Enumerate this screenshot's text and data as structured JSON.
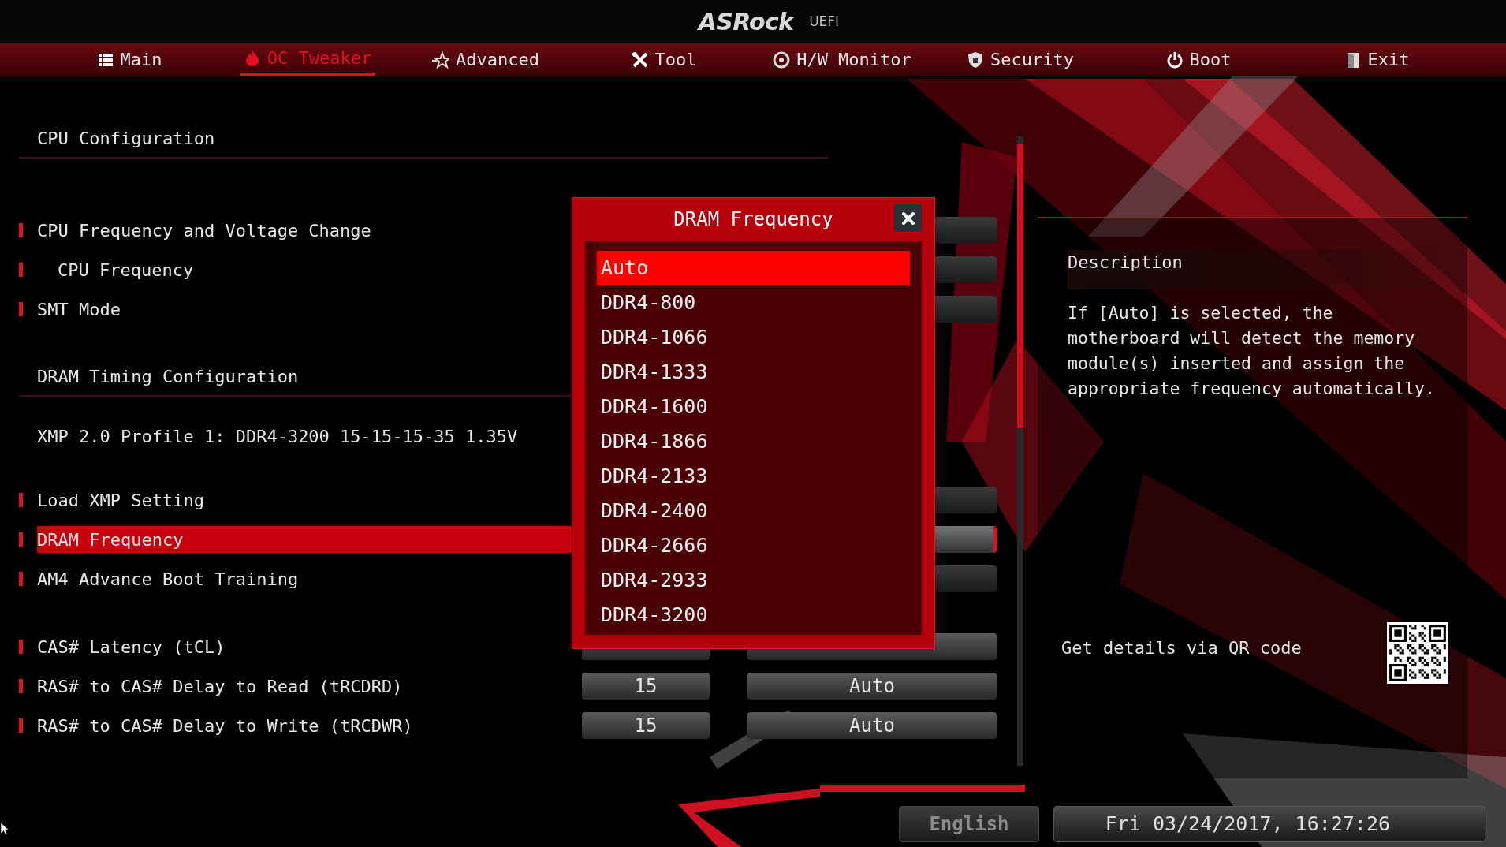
{
  "header": {
    "logo": "ASRock",
    "subtitle": "UEFI"
  },
  "tabs": [
    {
      "label": "Main",
      "kind": "list",
      "selected": false
    },
    {
      "label": "OC Tweaker",
      "kind": "flame",
      "selected": true
    },
    {
      "label": "Advanced",
      "kind": "star",
      "selected": false
    },
    {
      "label": "Tool",
      "kind": "tools",
      "selected": false
    },
    {
      "label": "H/W Monitor",
      "kind": "gauge",
      "selected": false
    },
    {
      "label": "Security",
      "kind": "shield",
      "selected": false
    },
    {
      "label": "Boot",
      "kind": "power",
      "selected": false
    },
    {
      "label": "Exit",
      "kind": "door",
      "selected": false
    }
  ],
  "settings": [
    [
      {
        "kind": "heading",
        "label": "CPU Configuration"
      }
    ],
    [
      {
        "kind": "item",
        "label": "CPU Frequency and Voltage Change",
        "selected": false,
        "children": [
          {
            "kind": "item",
            "label": "CPU Frequency",
            "selected": false
          }
        ]
      },
      {
        "kind": "item",
        "label": "SMT Mode",
        "selected": false
      }
    ],
    [
      {
        "kind": "heading",
        "label": "DRAM Timing Configuration"
      },
      {
        "kind": "info",
        "label": "XMP 2.0 Profile 1: DDR4-3200 15-15-15-35 1.35V"
      }
    ],
    [
      {
        "kind": "item",
        "label": "Load XMP Setting",
        "selected": false
      },
      {
        "kind": "item",
        "label": "DRAM Frequency",
        "selected": true
      },
      {
        "kind": "item",
        "label": "AM4 Advance Boot Training",
        "selected": false
      }
    ],
    [
      {
        "kind": "timing",
        "label": "CAS# Latency (tCL)",
        "selected": false
      },
      {
        "kind": "timing",
        "label": "RAS# to CAS# Delay to Read  (tRCDRD)",
        "selected": false,
        "values": [
          "15",
          "Auto"
        ]
      },
      {
        "kind": "timing",
        "label": "RAS# to CAS# Delay to Write (tRCDWR)",
        "selected": false,
        "values": [
          "15",
          "Auto"
        ]
      }
    ]
  ],
  "dialog": {
    "title": "DRAM Frequency",
    "options": [
      {
        "label": "Auto",
        "selected": true
      },
      {
        "label": "DDR4-800",
        "selected": false
      },
      {
        "label": "DDR4-1066",
        "selected": false
      },
      {
        "label": "DDR4-1333",
        "selected": false
      },
      {
        "label": "DDR4-1600",
        "selected": false
      },
      {
        "label": "DDR4-1866",
        "selected": false
      },
      {
        "label": "DDR4-2133",
        "selected": false
      },
      {
        "label": "DDR4-2400",
        "selected": false
      },
      {
        "label": "DDR4-2666",
        "selected": false
      },
      {
        "label": "DDR4-2933",
        "selected": false
      },
      {
        "label": "DDR4-3200",
        "selected": false
      }
    ]
  },
  "description": {
    "title": "Description",
    "text": "If [Auto] is selected, the motherboard will detect the memory module(s) inserted and assign the appropriate frequency automatically.",
    "qr_label": "Get details via QR code"
  },
  "footer": {
    "language": "English",
    "datetime": "Fri 03/24/2017, 16:27:26"
  }
}
